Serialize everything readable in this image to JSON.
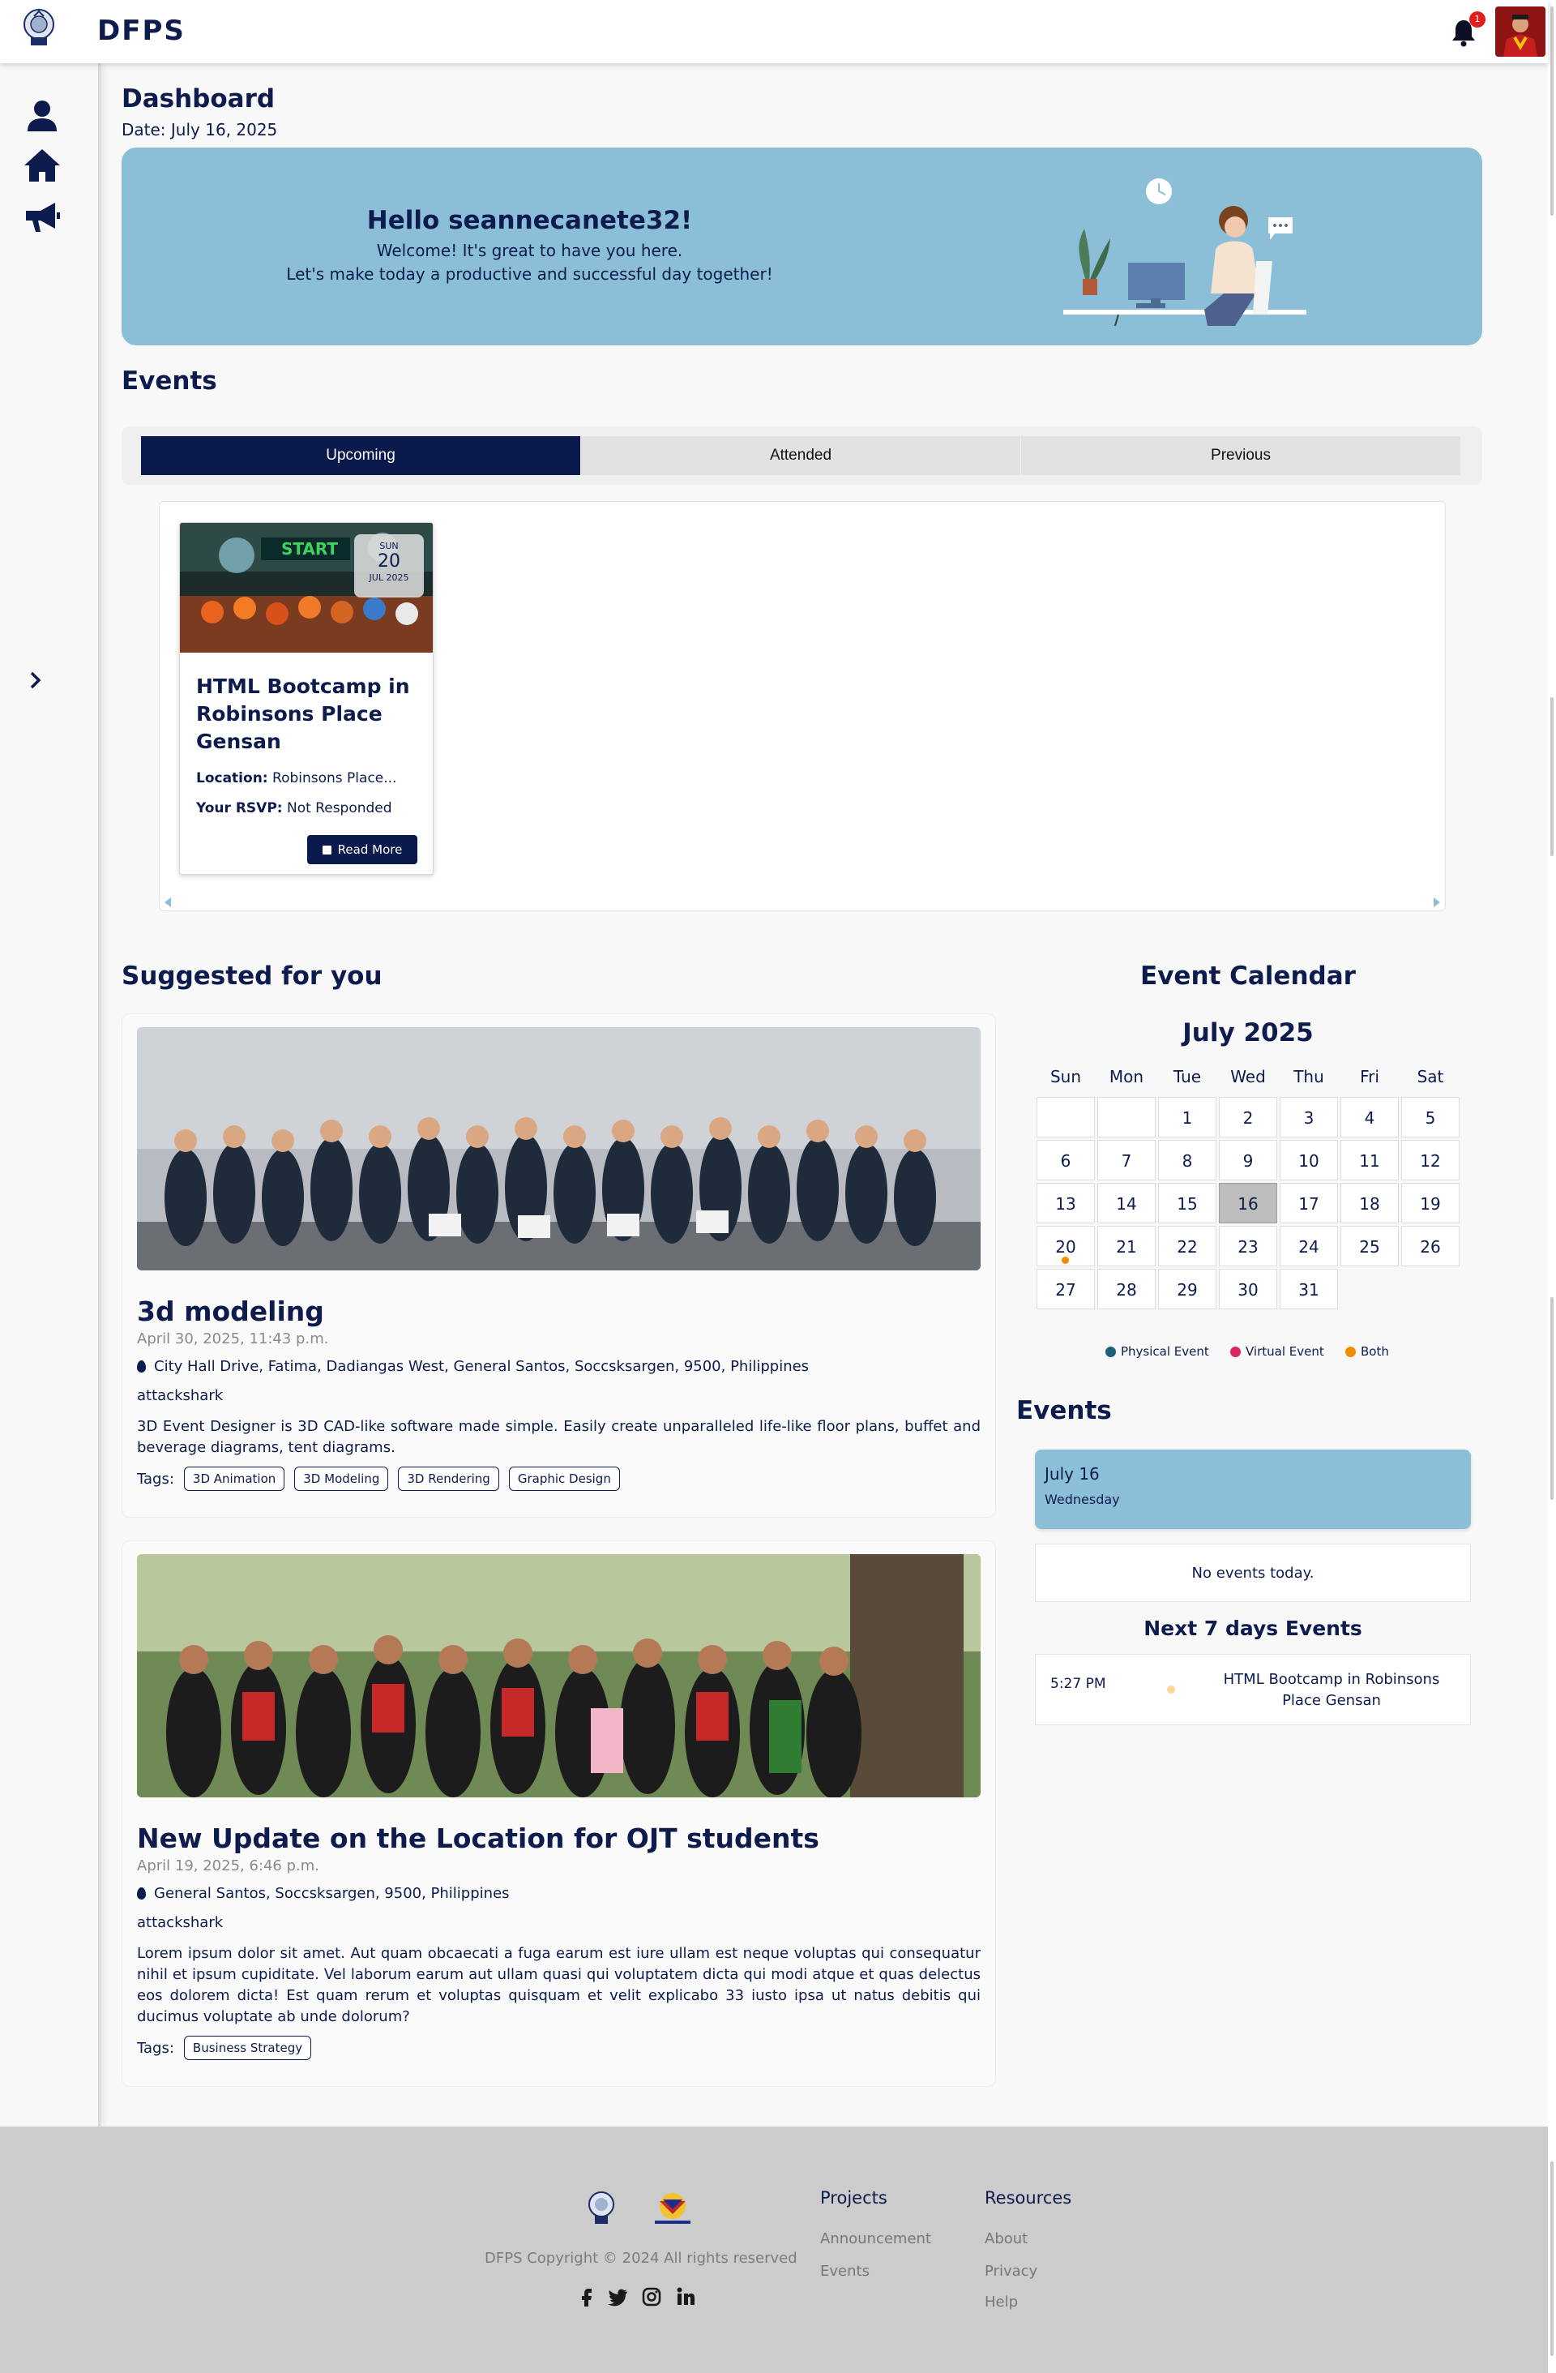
{
  "header": {
    "brand": "DFPS",
    "notification_count": "1"
  },
  "dashboard": {
    "title": "Dashboard",
    "date": "Date: July 16, 2025"
  },
  "hero": {
    "greeting": "Hello seannecanete32!",
    "line1": "Welcome! It's great to have you here.",
    "line2": "Let's make today a productive and successful day together!"
  },
  "events": {
    "title": "Events",
    "tabs": [
      {
        "label": "Upcoming",
        "active": true
      },
      {
        "label": "Attended",
        "active": false
      },
      {
        "label": "Previous",
        "active": false
      }
    ],
    "cards": [
      {
        "badge_day": "SUN",
        "badge_date": "20",
        "badge_month": "JUL 2025",
        "image_caption": "START",
        "title": "HTML Bootcamp in Robinsons Place Gensan",
        "location_label": "Location:",
        "location": "Robinsons Place...",
        "rsvp_label": "Your RSVP:",
        "rsvp": "Not Responded",
        "button": "Read More"
      }
    ]
  },
  "suggested": {
    "title": "Suggested for you",
    "tags_label": "Tags:",
    "posts": [
      {
        "title": "3d modeling",
        "date": "April 30, 2025, 11:43 p.m.",
        "location": "City Hall Drive, Fatima, Dadiangas West, General Santos, Soccsksargen, 9500, Philippines",
        "author": "attackshark",
        "description": "3D Event Designer is 3D CAD-like software made simple. Easily create unparalleled life-like floor plans, buffet and beverage diagrams, tent diagrams.",
        "tags": [
          "3D Animation",
          "3D Modeling",
          "3D Rendering",
          "Graphic Design"
        ]
      },
      {
        "title": "New Update on the Location for OJT students",
        "date": "April 19, 2025, 6:46 p.m.",
        "location": "General Santos, Soccsksargen, 9500, Philippines",
        "author": "attackshark",
        "description": "Lorem ipsum dolor sit amet. Aut quam obcaecati a fuga earum est iure ullam est neque voluptas qui consequatur nihil et ipsum cupiditate. Vel laborum earum aut ullam quasi qui voluptatem dicta qui modi atque et quas delectus eos dolorem dicta! Est quam rerum et voluptas quisquam et velit explicabo 33 iusto ipsa ut natus debitis qui ducimus voluptate ab unde dolorum?",
        "tags": [
          "Business Strategy"
        ]
      }
    ]
  },
  "calendar": {
    "title": "Event Calendar",
    "month": "July 2025",
    "weekdays": [
      "Sun",
      "Mon",
      "Tue",
      "Wed",
      "Thu",
      "Fri",
      "Sat"
    ],
    "days": [
      "1",
      "2",
      "3",
      "4",
      "5",
      "6",
      "7",
      "8",
      "9",
      "10",
      "11",
      "12",
      "13",
      "14",
      "15",
      "16",
      "17",
      "18",
      "19",
      "20",
      "21",
      "22",
      "23",
      "24",
      "25",
      "26",
      "27",
      "28",
      "29",
      "30",
      "31"
    ],
    "first_weekday": 2,
    "today": "16",
    "event_days": [
      "20"
    ],
    "legend": [
      {
        "label": "Physical Event",
        "color": "#1d5f7a"
      },
      {
        "label": "Virtual Event",
        "color": "#e0245e"
      },
      {
        "label": "Both",
        "color": "#f28c00"
      }
    ]
  },
  "day_events": {
    "title": "Events",
    "today_date": "July 16",
    "today_weekday": "Wednesday",
    "no_events": "No events today.",
    "next7_title": "Next 7 days Events",
    "next7": [
      {
        "time": "5:27 PM",
        "name": "HTML Bootcamp in Robinsons Place Gensan"
      }
    ]
  },
  "footer": {
    "copyright": "DFPS Copyright © 2024 All rights reserved",
    "projects_title": "Projects",
    "projects": [
      "Announcement",
      "Events"
    ],
    "resources_title": "Resources",
    "resources": [
      "About",
      "Privacy",
      "Help"
    ],
    "social": [
      "facebook-icon",
      "twitter-icon",
      "instagram-icon",
      "linkedin-icon"
    ]
  },
  "colors": {
    "navy": "#0b1a4d",
    "hero_blue": "#8bbfd8",
    "badge_red": "#e01e1e"
  }
}
